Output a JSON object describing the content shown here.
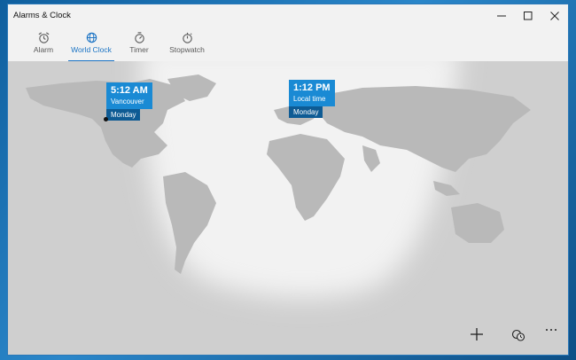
{
  "window": {
    "title": "Alarms & Clock"
  },
  "tabs": [
    {
      "label": "Alarm",
      "icon": "alarm-clock-icon",
      "active": false
    },
    {
      "label": "World Clock",
      "icon": "globe-icon",
      "active": true
    },
    {
      "label": "Timer",
      "icon": "timer-icon",
      "active": false
    },
    {
      "label": "Stopwatch",
      "icon": "stopwatch-icon",
      "active": false
    }
  ],
  "clocks": [
    {
      "time": "5:12 AM",
      "city": "Vancouver",
      "day": "Monday"
    },
    {
      "time": "1:12 PM",
      "city": "Local time",
      "day": "Monday"
    }
  ],
  "commands": {
    "add": "plus-icon",
    "compare": "compare-clocks-icon",
    "more": "more-icon"
  },
  "colors": {
    "accent": "#1a73c4",
    "card": "#1a8ad4",
    "card_day": "#0e5b94",
    "map_bg": "#dcdcdc",
    "land": "#c7c7c7"
  }
}
